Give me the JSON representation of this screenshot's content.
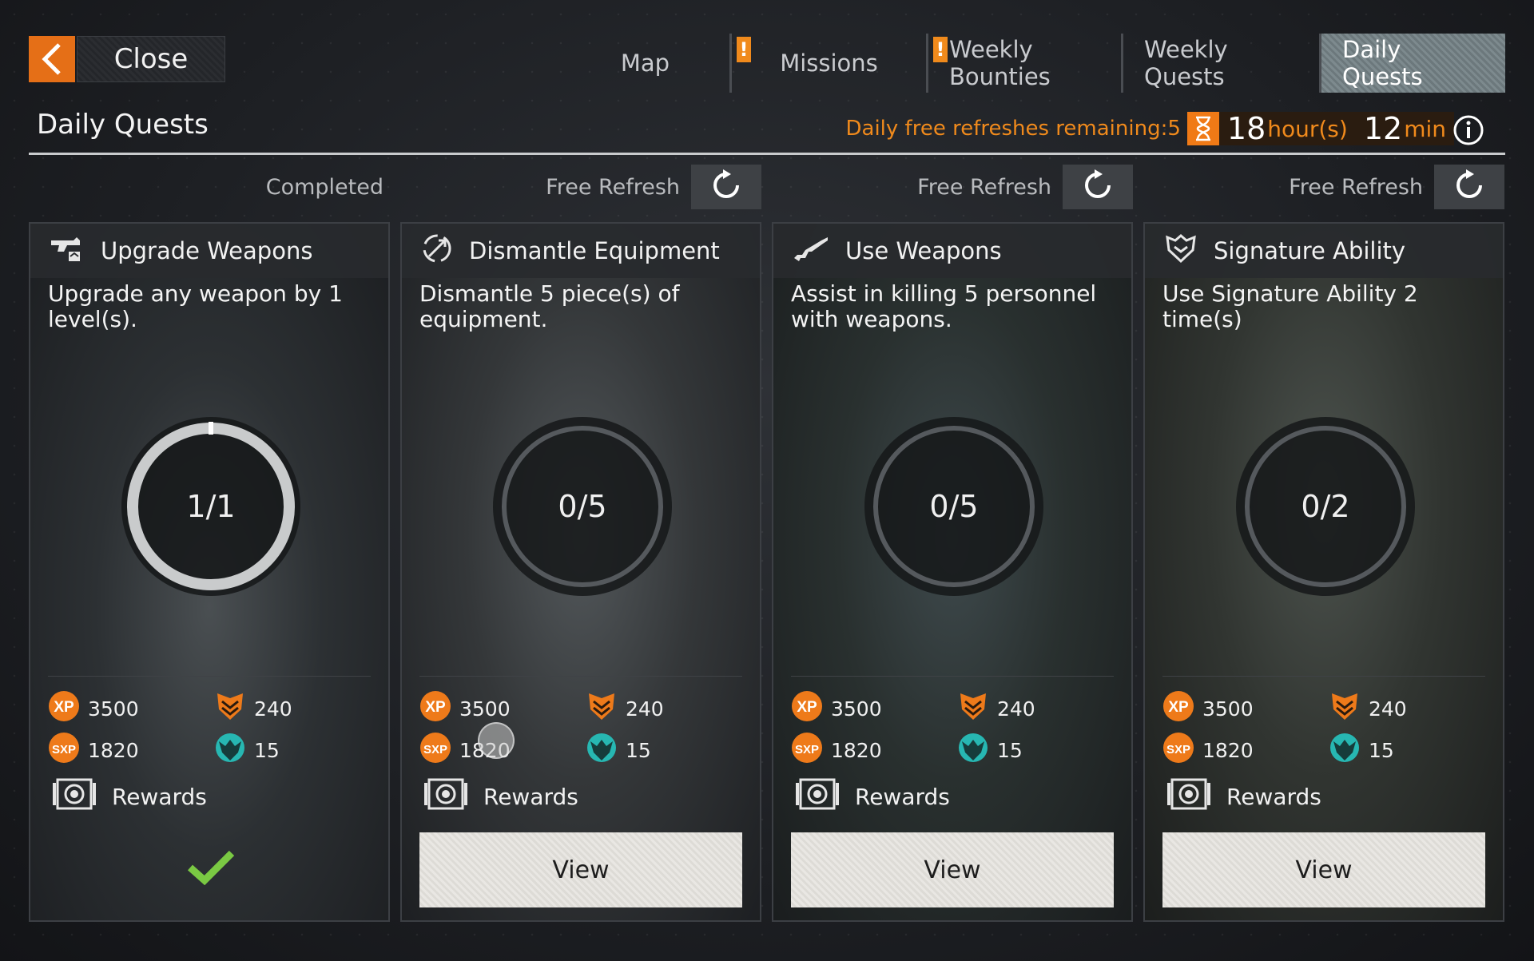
{
  "nav": {
    "close_label": "Close",
    "tabs": [
      {
        "label": "Map",
        "alert": ""
      },
      {
        "label": "Missions",
        "alert": "!"
      },
      {
        "label": "Weekly Bounties",
        "alert": "!"
      },
      {
        "label": "Weekly Quests",
        "alert": ""
      },
      {
        "label": "Daily Quests",
        "alert": "",
        "active": true
      }
    ]
  },
  "header": {
    "title": "Daily Quests",
    "refreshes_text": "Daily free refreshes remaining:5",
    "timer_hours": "18",
    "timer_hours_unit": "hour(s)",
    "timer_minutes": "12",
    "timer_minutes_unit": "min"
  },
  "colors": {
    "accent": "#f07a16",
    "active_tab": "#76838a",
    "check": "#7ac943",
    "view_button": "#e4e2de"
  },
  "cards": [
    {
      "status_label": "Completed",
      "icon": "upgrade-weapon-icon",
      "title": "Upgrade Weapons",
      "description": "Upgrade any weapon by 1 level(s).",
      "progress": "1/1",
      "progress_fraction": 1.0,
      "xp": "3500",
      "sxp": "1820",
      "credits": "240",
      "tokens": "15",
      "rewards_label": "Rewards",
      "completed": true
    },
    {
      "status_label": "Free Refresh",
      "icon": "dismantle-icon",
      "title": "Dismantle Equipment",
      "description": "Dismantle 5 piece(s) of equipment.",
      "progress": "0/5",
      "progress_fraction": 0,
      "xp": "3500",
      "sxp": "1820",
      "credits": "240",
      "tokens": "15",
      "rewards_label": "Rewards",
      "view_label": "View"
    },
    {
      "status_label": "Free Refresh",
      "icon": "rifle-icon",
      "title": "Use Weapons",
      "description": "Assist in killing 5 personnel with weapons.",
      "progress": "0/5",
      "progress_fraction": 0,
      "xp": "3500",
      "sxp": "1820",
      "credits": "240",
      "tokens": "15",
      "rewards_label": "Rewards",
      "view_label": "View"
    },
    {
      "status_label": "Free Refresh",
      "icon": "signature-ability-icon",
      "title": "Signature Ability",
      "description": "Use Signature Ability 2 time(s)",
      "progress": "0/2",
      "progress_fraction": 0,
      "xp": "3500",
      "sxp": "1820",
      "credits": "240",
      "tokens": "15",
      "rewards_label": "Rewards",
      "view_label": "View"
    }
  ]
}
